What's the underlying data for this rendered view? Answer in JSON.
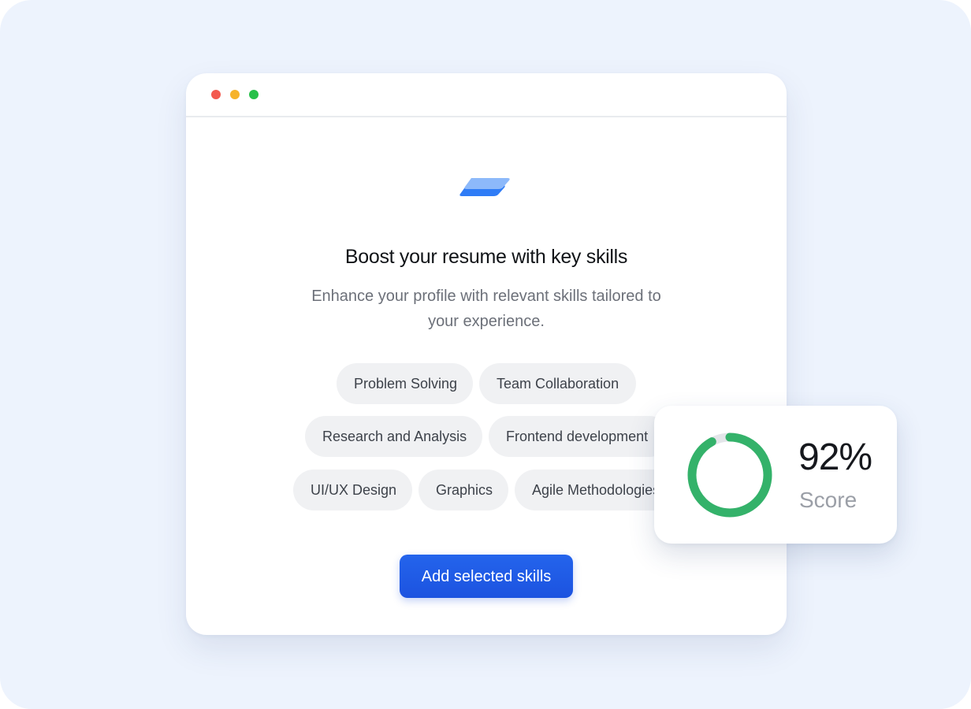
{
  "card": {
    "title": "Boost your resume with key skills",
    "subtitle": "Enhance your profile with relevant skills tailored to your experience.",
    "logo_icon": "stacked-layers-icon",
    "cta_label": "Add selected skills"
  },
  "skills": [
    {
      "label": "Problem Solving"
    },
    {
      "label": "Team Collaboration"
    },
    {
      "label": "Research and Analysis"
    },
    {
      "label": "Frontend development"
    },
    {
      "label": "UI/UX Design"
    },
    {
      "label": "Graphics"
    },
    {
      "label": "Agile Methodologies"
    }
  ],
  "score": {
    "value": 92,
    "value_label": "92%",
    "label": "Score"
  },
  "colors": {
    "background": "#edf3fd",
    "accent": "#1f5ae6",
    "ring_progress": "#34b26a",
    "ring_track": "#e3e5e9",
    "chip_background": "#f0f1f3",
    "window_dot_red": "#f35a4f",
    "window_dot_yellow": "#f6b32b",
    "window_dot_green": "#27c049"
  }
}
